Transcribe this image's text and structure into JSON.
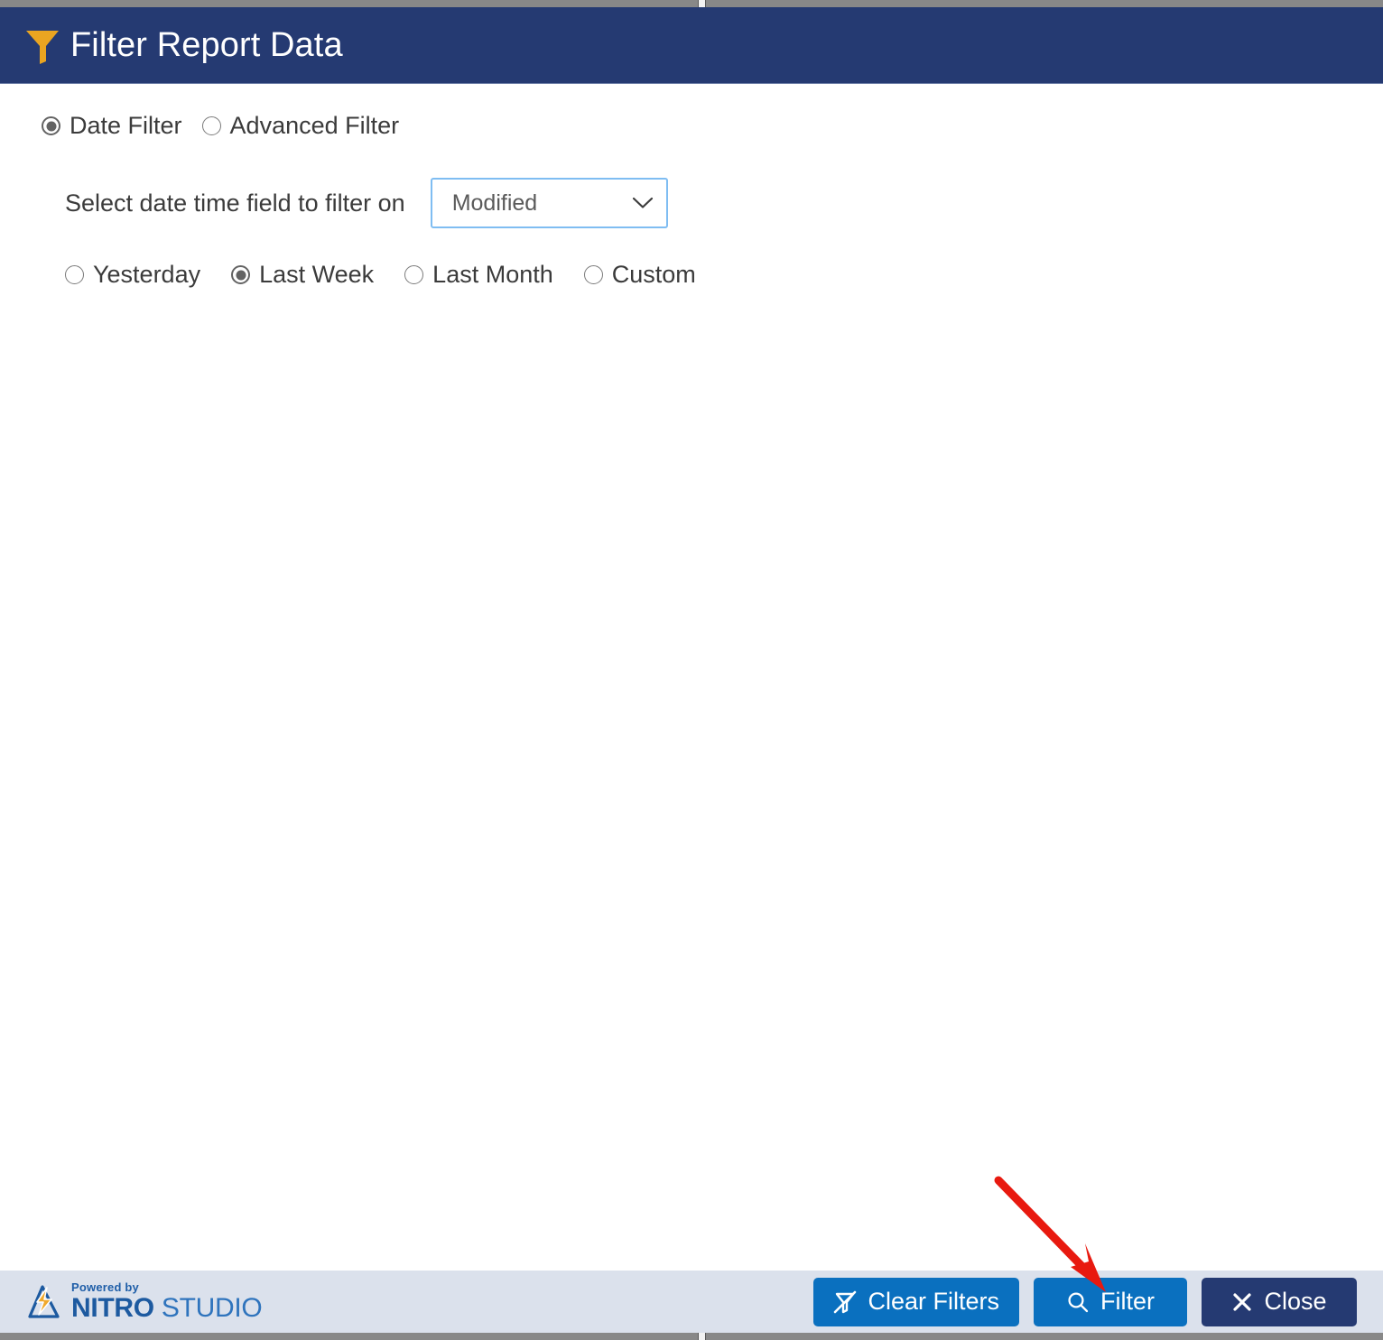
{
  "window": {
    "title": "Filter Report Data",
    "title_icon": "funnel-icon",
    "header_bg": "#253a72",
    "footer_bg": "#dbe1ec"
  },
  "filter_mode": {
    "options": [
      {
        "label": "Date Filter",
        "selected": true
      },
      {
        "label": "Advanced Filter",
        "selected": false
      }
    ]
  },
  "date_field": {
    "label": "Select date time field to filter on",
    "selected_value": "Modified",
    "caret_icon": "chevron-down-icon"
  },
  "date_range": {
    "options": [
      {
        "label": "Yesterday",
        "selected": false
      },
      {
        "label": "Last Week",
        "selected": true
      },
      {
        "label": "Last Month",
        "selected": false
      },
      {
        "label": "Custom",
        "selected": false
      }
    ]
  },
  "footer": {
    "logo": {
      "powered_by": "Powered by",
      "brand_primary": "NITRO",
      "brand_secondary": "STUDIO",
      "mark_icon": "nitro-bolt-logo-icon"
    },
    "buttons": [
      {
        "label": "Clear Filters",
        "icon": "clear-filter-icon",
        "color": "#0a70bf"
      },
      {
        "label": "Filter",
        "icon": "search-icon",
        "color": "#0a70bf"
      },
      {
        "label": "Close",
        "icon": "close-x-icon",
        "color": "#253a72"
      }
    ]
  },
  "annotation": {
    "arrow_color": "#e8190f",
    "points_to": "Filter"
  }
}
